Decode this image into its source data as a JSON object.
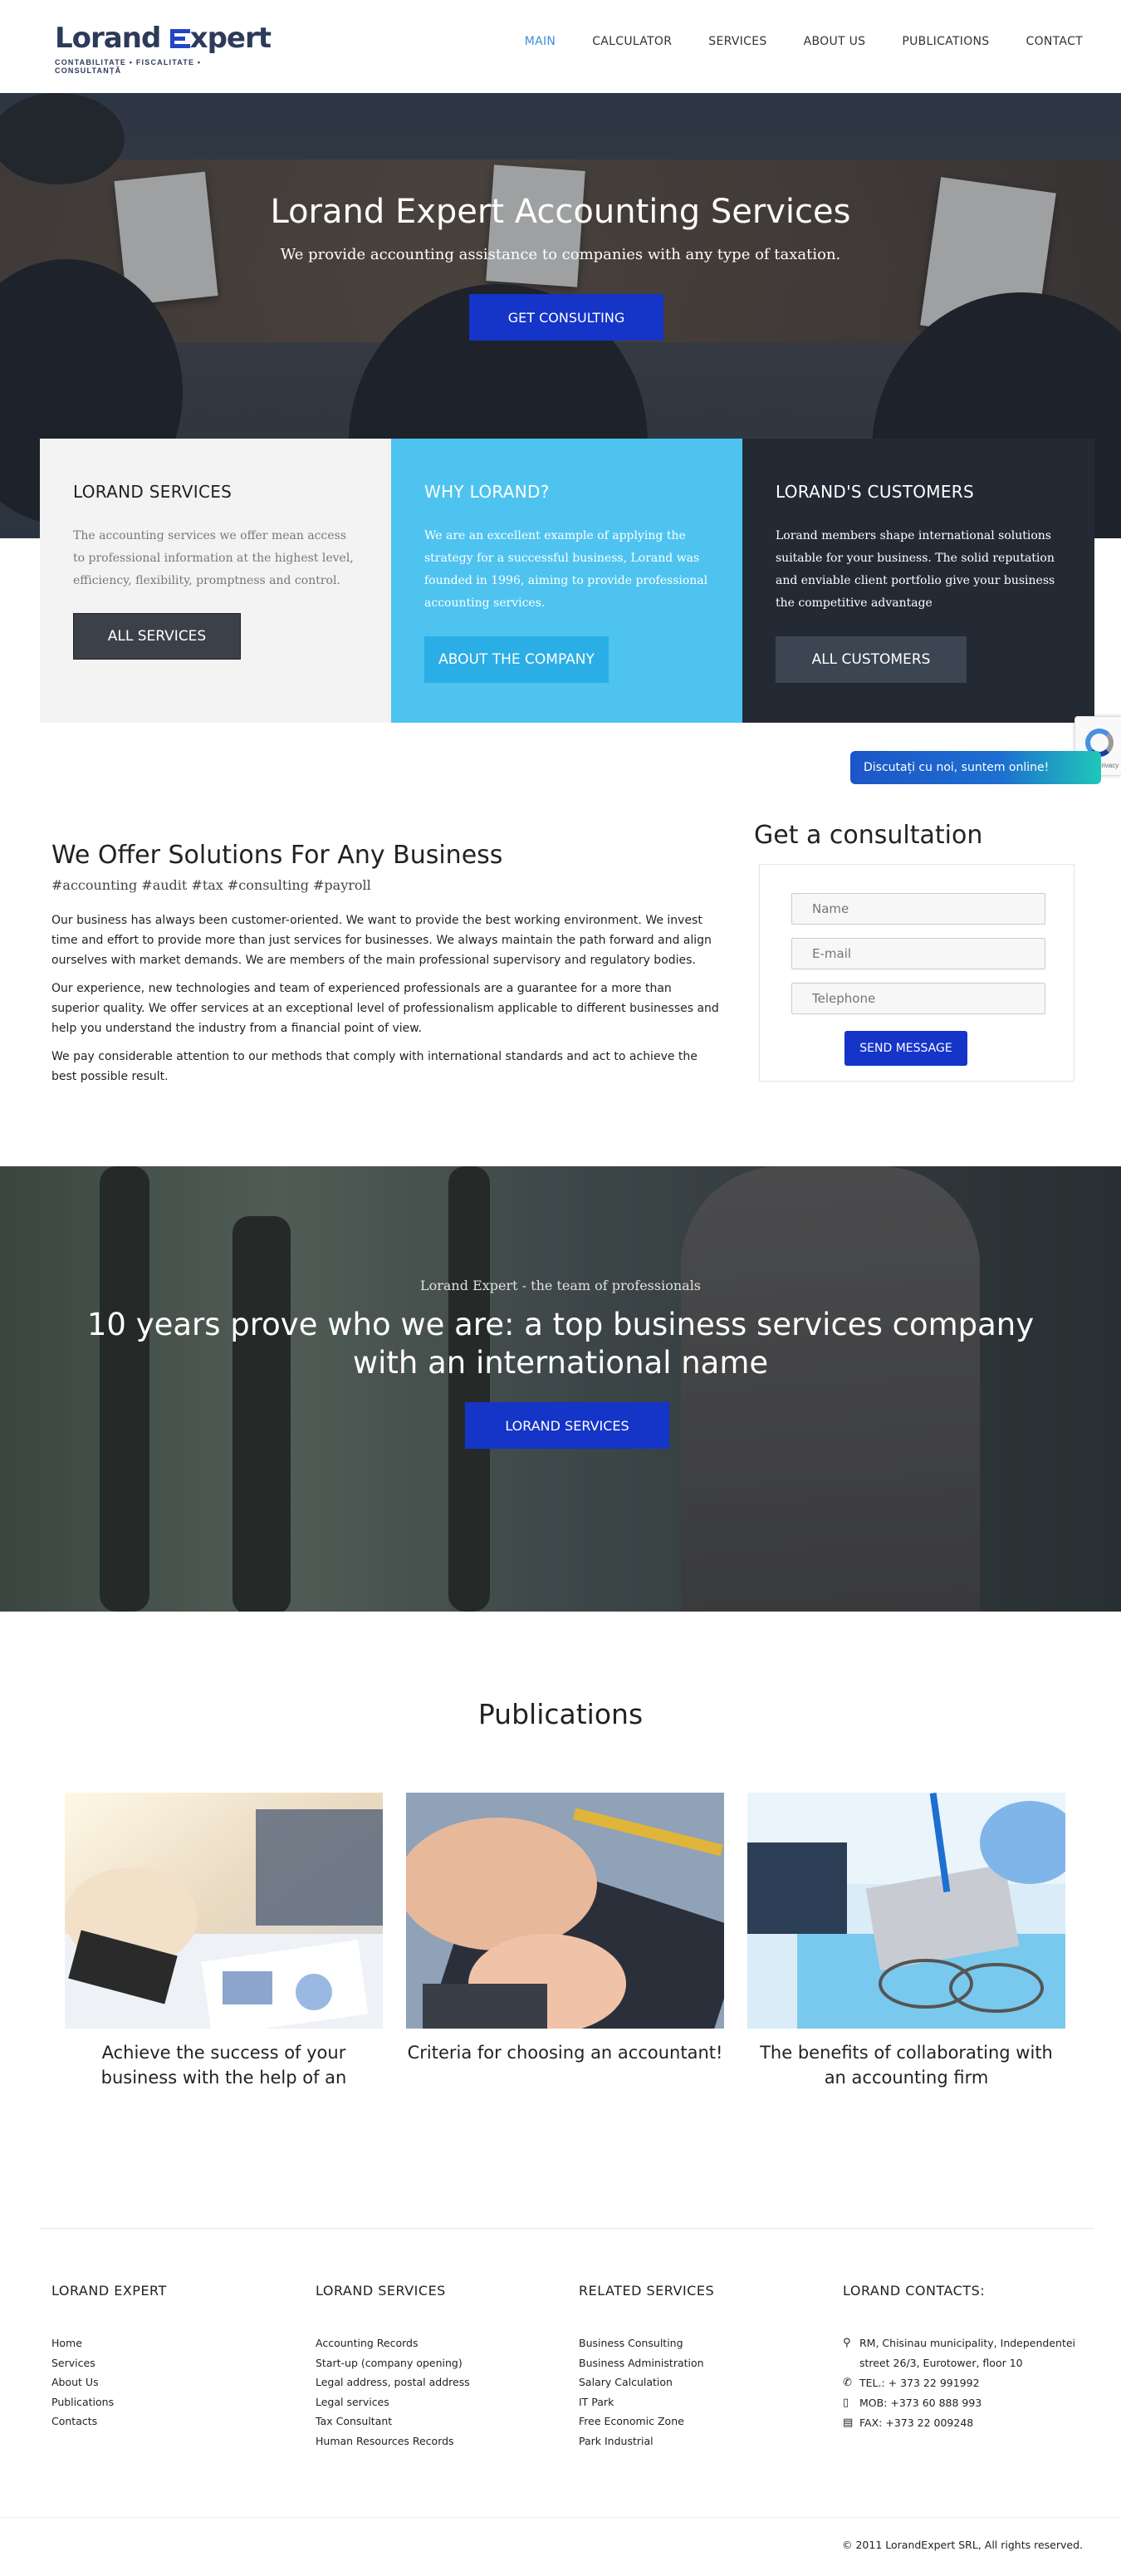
{
  "header": {
    "logo_word1": "Lorand",
    "logo_word2": "xpert",
    "logo_tagline": "CONTABILITATE • FISCALITATE • CONSULTANȚĂ",
    "nav": [
      "MAIN",
      "CALCULATOR",
      "SERVICES",
      "ABOUT US",
      "PUBLICATIONS",
      "CONTACT"
    ],
    "active_nav": "MAIN",
    "active_color": "#3a8fd8"
  },
  "hero": {
    "title": "Lorand Expert Accounting Services",
    "subtitle": "We provide accounting assistance to companies with any type of taxation.",
    "button": "GET CONSULTING"
  },
  "boxes": [
    {
      "title": "LORAND SERVICES",
      "text": "The accounting services we offer mean access to professional information at the highest level, efficiency, flexibility, promptness and control.",
      "button": "ALL SERVICES"
    },
    {
      "title": "WHY LORAND?",
      "text": "We are an excellent example of applying the strategy for a successful business, Lorand was founded in 1996, aiming to provide professional accounting services.",
      "button": "ABOUT THE COMPANY"
    },
    {
      "title": "LORAND'S CUSTOMERS",
      "text": "Lorand members shape international solutions suitable for your business. The solid reputation and enviable client portfolio give your business the competitive advantage",
      "button": "ALL CUSTOMERS"
    }
  ],
  "chat": {
    "label": "Discutați cu noi, suntem online!"
  },
  "recaptcha": {
    "text": "Privacy - Terms"
  },
  "solutions": {
    "title": "We Offer Solutions For Any Business",
    "tags": "#accounting #audit #tax #consulting #payroll",
    "paragraphs": [
      "Our business has always been customer-oriented. We want to provide the best working environment. We invest time and effort to provide more than just services for businesses. We always maintain the path forward and align ourselves with market demands. We are members of the main professional supervisory and regulatory bodies.",
      "Our experience, new technologies and team of experienced professionals are a guarantee for a more than superior quality. We offer services at an exceptional level of professionalism applicable to different businesses and help you understand the industry from a financial point of view.",
      "We pay considerable attention to our methods that comply with international standards and act to achieve the best possible result."
    ]
  },
  "consultation": {
    "title": "Get a consultation",
    "name_placeholder": "Name",
    "email_placeholder": "E-mail",
    "phone_placeholder": "Telephone",
    "button": "SEND MESSAGE"
  },
  "banner": {
    "kicker": "Lorand Expert - the team of professionals",
    "title_line1": "10 years prove who we are: a top business services company",
    "title_line2": "with an international name",
    "button": "LORAND SERVICES"
  },
  "publications": {
    "title": "Publications",
    "items": [
      {
        "caption": "Achieve the success of your business with the help of an accounting firm"
      },
      {
        "caption": "Criteria for choosing an accountant!"
      },
      {
        "caption": "The benefits of collaborating with an accounting firm"
      }
    ]
  },
  "footer": {
    "col1": {
      "title": "LORAND EXPERT",
      "links": [
        "Home",
        "Services",
        "About Us",
        "Publications",
        "Contacts"
      ]
    },
    "col2": {
      "title": "LORAND SERVICES",
      "links": [
        "Accounting Records",
        "Start-up (company opening)",
        "Legal address, postal address",
        "Legal services",
        "Tax Consultant",
        "Human Resources Records"
      ]
    },
    "col3": {
      "title": "RELATED SERVICES",
      "links": [
        "Business Consulting",
        "Business Administration",
        "Salary Calculation",
        "IT Park",
        "Free Economic Zone",
        "Park Industrial"
      ]
    },
    "col4": {
      "title": "LORAND CONTACTS:",
      "address": "RM, Chisinau municipality, Independentei street 26/3, Eurotower, floor 10",
      "tel": "TEL.: + 373 22 991992",
      "mob": "MOB: +373 60 888 993",
      "fax": "FAX: +373 22 009248"
    },
    "copyright": "© 2011 LorandExpert SRL, All rights reserved."
  }
}
